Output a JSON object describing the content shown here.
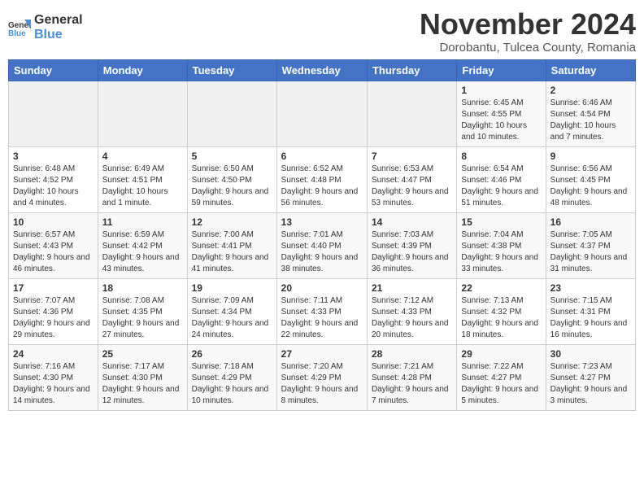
{
  "header": {
    "logo_general": "General",
    "logo_blue": "Blue",
    "month_title": "November 2024",
    "subtitle": "Dorobantu, Tulcea County, Romania"
  },
  "weekdays": [
    "Sunday",
    "Monday",
    "Tuesday",
    "Wednesday",
    "Thursday",
    "Friday",
    "Saturday"
  ],
  "weeks": [
    [
      {
        "day": "",
        "info": ""
      },
      {
        "day": "",
        "info": ""
      },
      {
        "day": "",
        "info": ""
      },
      {
        "day": "",
        "info": ""
      },
      {
        "day": "",
        "info": ""
      },
      {
        "day": "1",
        "info": "Sunrise: 6:45 AM\nSunset: 4:55 PM\nDaylight: 10 hours and 10 minutes."
      },
      {
        "day": "2",
        "info": "Sunrise: 6:46 AM\nSunset: 4:54 PM\nDaylight: 10 hours and 7 minutes."
      }
    ],
    [
      {
        "day": "3",
        "info": "Sunrise: 6:48 AM\nSunset: 4:52 PM\nDaylight: 10 hours and 4 minutes."
      },
      {
        "day": "4",
        "info": "Sunrise: 6:49 AM\nSunset: 4:51 PM\nDaylight: 10 hours and 1 minute."
      },
      {
        "day": "5",
        "info": "Sunrise: 6:50 AM\nSunset: 4:50 PM\nDaylight: 9 hours and 59 minutes."
      },
      {
        "day": "6",
        "info": "Sunrise: 6:52 AM\nSunset: 4:48 PM\nDaylight: 9 hours and 56 minutes."
      },
      {
        "day": "7",
        "info": "Sunrise: 6:53 AM\nSunset: 4:47 PM\nDaylight: 9 hours and 53 minutes."
      },
      {
        "day": "8",
        "info": "Sunrise: 6:54 AM\nSunset: 4:46 PM\nDaylight: 9 hours and 51 minutes."
      },
      {
        "day": "9",
        "info": "Sunrise: 6:56 AM\nSunset: 4:45 PM\nDaylight: 9 hours and 48 minutes."
      }
    ],
    [
      {
        "day": "10",
        "info": "Sunrise: 6:57 AM\nSunset: 4:43 PM\nDaylight: 9 hours and 46 minutes."
      },
      {
        "day": "11",
        "info": "Sunrise: 6:59 AM\nSunset: 4:42 PM\nDaylight: 9 hours and 43 minutes."
      },
      {
        "day": "12",
        "info": "Sunrise: 7:00 AM\nSunset: 4:41 PM\nDaylight: 9 hours and 41 minutes."
      },
      {
        "day": "13",
        "info": "Sunrise: 7:01 AM\nSunset: 4:40 PM\nDaylight: 9 hours and 38 minutes."
      },
      {
        "day": "14",
        "info": "Sunrise: 7:03 AM\nSunset: 4:39 PM\nDaylight: 9 hours and 36 minutes."
      },
      {
        "day": "15",
        "info": "Sunrise: 7:04 AM\nSunset: 4:38 PM\nDaylight: 9 hours and 33 minutes."
      },
      {
        "day": "16",
        "info": "Sunrise: 7:05 AM\nSunset: 4:37 PM\nDaylight: 9 hours and 31 minutes."
      }
    ],
    [
      {
        "day": "17",
        "info": "Sunrise: 7:07 AM\nSunset: 4:36 PM\nDaylight: 9 hours and 29 minutes."
      },
      {
        "day": "18",
        "info": "Sunrise: 7:08 AM\nSunset: 4:35 PM\nDaylight: 9 hours and 27 minutes."
      },
      {
        "day": "19",
        "info": "Sunrise: 7:09 AM\nSunset: 4:34 PM\nDaylight: 9 hours and 24 minutes."
      },
      {
        "day": "20",
        "info": "Sunrise: 7:11 AM\nSunset: 4:33 PM\nDaylight: 9 hours and 22 minutes."
      },
      {
        "day": "21",
        "info": "Sunrise: 7:12 AM\nSunset: 4:33 PM\nDaylight: 9 hours and 20 minutes."
      },
      {
        "day": "22",
        "info": "Sunrise: 7:13 AM\nSunset: 4:32 PM\nDaylight: 9 hours and 18 minutes."
      },
      {
        "day": "23",
        "info": "Sunrise: 7:15 AM\nSunset: 4:31 PM\nDaylight: 9 hours and 16 minutes."
      }
    ],
    [
      {
        "day": "24",
        "info": "Sunrise: 7:16 AM\nSunset: 4:30 PM\nDaylight: 9 hours and 14 minutes."
      },
      {
        "day": "25",
        "info": "Sunrise: 7:17 AM\nSunset: 4:30 PM\nDaylight: 9 hours and 12 minutes."
      },
      {
        "day": "26",
        "info": "Sunrise: 7:18 AM\nSunset: 4:29 PM\nDaylight: 9 hours and 10 minutes."
      },
      {
        "day": "27",
        "info": "Sunrise: 7:20 AM\nSunset: 4:29 PM\nDaylight: 9 hours and 8 minutes."
      },
      {
        "day": "28",
        "info": "Sunrise: 7:21 AM\nSunset: 4:28 PM\nDaylight: 9 hours and 7 minutes."
      },
      {
        "day": "29",
        "info": "Sunrise: 7:22 AM\nSunset: 4:27 PM\nDaylight: 9 hours and 5 minutes."
      },
      {
        "day": "30",
        "info": "Sunrise: 7:23 AM\nSunset: 4:27 PM\nDaylight: 9 hours and 3 minutes."
      }
    ]
  ]
}
